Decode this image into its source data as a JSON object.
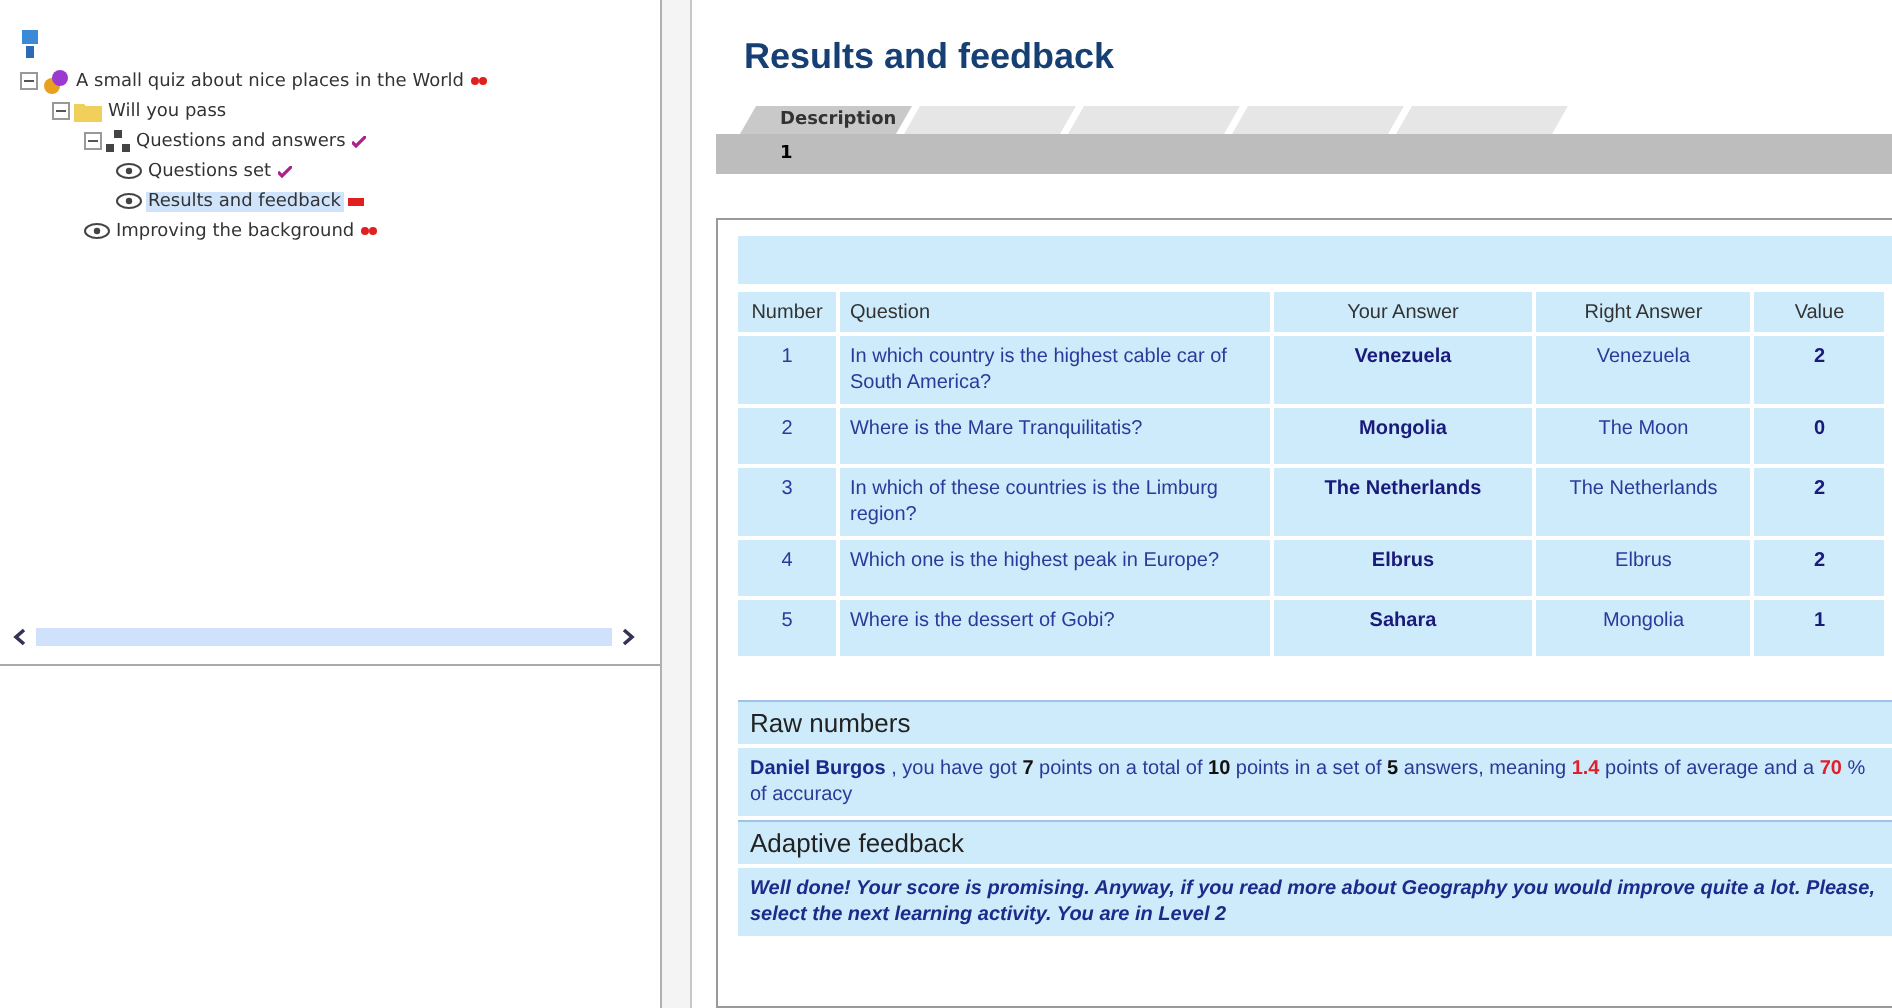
{
  "tree": [
    {
      "label": "A small quiz about nice places in the World",
      "kind": "quiz",
      "badge": {
        "kind": "infinite"
      },
      "selected": false,
      "expanded": true,
      "children": [
        {
          "label": "Will you pass",
          "kind": "folder",
          "expanded": true,
          "selected": false,
          "children": [
            {
              "label": "Questions and answers",
              "kind": "group",
              "badge": {
                "kind": "done"
              },
              "expanded": true,
              "selected": false,
              "children": [
                {
                  "label": "Questions set",
                  "kind": "activity",
                  "badge": {
                    "kind": "done"
                  },
                  "selected": false
                },
                {
                  "label": "Results and feedback",
                  "kind": "activity",
                  "badge": {
                    "kind": "current"
                  },
                  "selected": true
                }
              ]
            },
            {
              "label": "Improving the background",
              "kind": "activity",
              "badge": {
                "kind": "infinite"
              },
              "selected": false
            }
          ]
        }
      ]
    }
  ],
  "title": "Results and feedback",
  "tabs": [
    {
      "label": "Description",
      "selected": true
    },
    {
      "selected": false
    },
    {
      "selected": false
    },
    {
      "selected": false
    },
    {
      "selected": false
    }
  ],
  "page_number": "1",
  "table": {
    "columns": [
      "Number",
      "Question",
      "Your Answer",
      "Right Answer",
      "Value"
    ],
    "rows": [
      [
        "1",
        "In which country is the highest cable car of South America?",
        "Venezuela",
        "Venezuela",
        "2"
      ],
      [
        "2",
        "Where is the Mare Tranquilitatis?",
        "Mongolia",
        "The Moon",
        "0"
      ],
      [
        "3",
        "In which of these countries is the Limburg region?",
        "The Netherlands",
        "The Netherlands",
        "2"
      ],
      [
        "4",
        "Which one is the highest peak in Europe?",
        "Elbrus",
        "Elbrus",
        "2"
      ],
      [
        "5",
        "Where is the dessert of Gobi?",
        "Sahara",
        "Mongolia",
        "1"
      ]
    ]
  },
  "raw_numbers": {
    "heading": "Raw numbers",
    "segments": [
      {
        "text": "Daniel Burgos",
        "kind": "name"
      },
      {
        "text": " , you have got ",
        "kind": "plain"
      },
      {
        "text": "7",
        "kind": "bold"
      },
      {
        "text": " points on a total of ",
        "kind": "plain"
      },
      {
        "text": "10",
        "kind": "bold"
      },
      {
        "text": " points in a set of ",
        "kind": "plain"
      },
      {
        "text": "5",
        "kind": "bold"
      },
      {
        "text": " answers, meaning ",
        "kind": "plain"
      },
      {
        "text": "1.4",
        "kind": "alert"
      },
      {
        "text": " points of average and a ",
        "kind": "plain"
      },
      {
        "text": "70",
        "kind": "alert"
      },
      {
        "text": " % of accuracy",
        "kind": "plain"
      }
    ]
  },
  "adaptive_feedback": {
    "heading": "Adaptive feedback",
    "text": "Well done! Your score is promising. Anyway, if you read more about Geography you would improve quite a lot. Please, select the next learning activity. You are in Level 2"
  }
}
